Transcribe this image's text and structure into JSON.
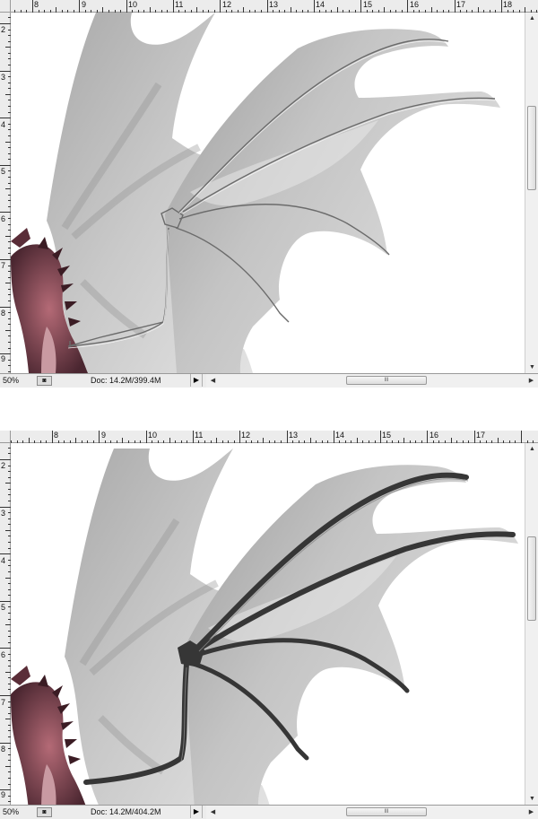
{
  "panels": [
    {
      "ruler_h": [
        "8",
        "9",
        "10",
        "11",
        "12",
        "13",
        "14",
        "15",
        "16",
        "17",
        "18"
      ],
      "ruler_v": [
        "2",
        "3",
        "4",
        "5",
        "6",
        "7",
        "8",
        "9"
      ],
      "zoom": "50%",
      "doc": "Doc: 14.2M/399.4M",
      "status_icon": "status-info-icon",
      "menu_arrow": "▶",
      "left_arrow": "◀",
      "right_arrow": "▶",
      "up_arrow": "▲",
      "down_arrow": "▼",
      "grip": "III",
      "bone_style": "outline"
    },
    {
      "ruler_h": [
        "8",
        "9",
        "10",
        "11",
        "12",
        "13",
        "14",
        "15",
        "16",
        "17"
      ],
      "ruler_v": [
        "2",
        "3",
        "4",
        "5",
        "6",
        "7",
        "8",
        "9"
      ],
      "zoom": "50%",
      "doc": "Doc: 14.2M/404.2M",
      "status_icon": "status-info-icon",
      "menu_arrow": "▶",
      "left_arrow": "◀",
      "right_arrow": "▶",
      "up_arrow": "▲",
      "down_arrow": "▼",
      "grip": "III",
      "bone_style": "filled"
    }
  ],
  "colors": {
    "ruler_bg": "#ececec",
    "wing_membrane": "#bdbdbd",
    "bone_dark": "#3a3a3a",
    "dragon_body": "#6e3b45"
  }
}
